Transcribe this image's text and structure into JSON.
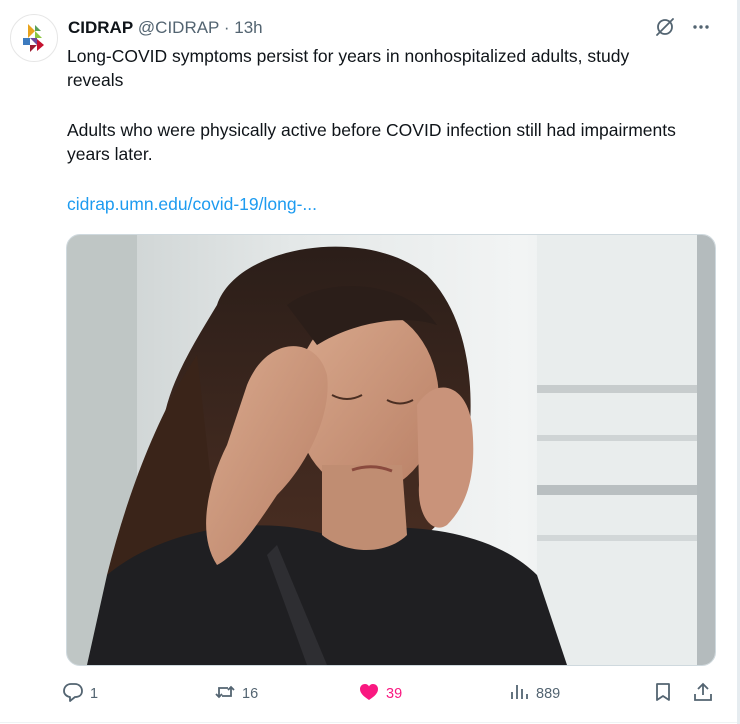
{
  "tweet": {
    "display_name": "CIDRAP",
    "handle": "@CIDRAP",
    "separator": "·",
    "time": "13h",
    "text_line1": "Long-COVID symptoms persist for years in nonhospitalized adults, study reveals",
    "text_line2": "Adults who were physically active before COVID infection still had impairments years later.",
    "link": "cidrap.umn.edu/covid-19/long-..."
  },
  "actions": {
    "reply_count": "1",
    "retweet_count": "16",
    "like_count": "39",
    "view_count": "889"
  },
  "colors": {
    "link": "#1d9bf0",
    "like": "#f91880",
    "muted": "#536471"
  },
  "icons": [
    "grok-icon",
    "more-icon",
    "reply-icon",
    "retweet-icon",
    "like-icon",
    "views-icon",
    "bookmark-icon",
    "share-icon"
  ]
}
